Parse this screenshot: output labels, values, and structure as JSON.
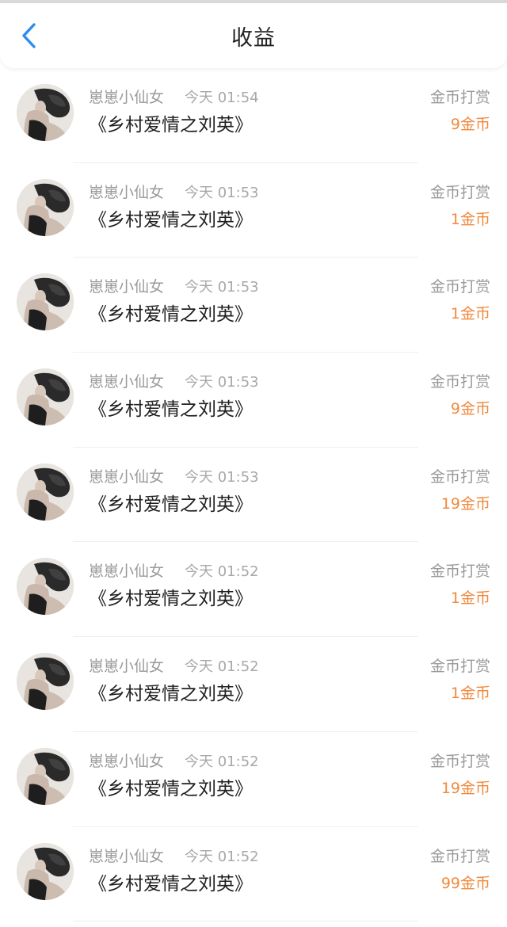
{
  "header": {
    "title": "收益",
    "back_icon": "chevron-left-icon",
    "accent": "#2d8cf0"
  },
  "amount_color": "#f08a3e",
  "records": [
    {
      "user": "崽崽小仙女",
      "time": "今天 01:54",
      "work": "《乡村爱情之刘英》",
      "type": "金币打赏",
      "amount": "9金币"
    },
    {
      "user": "崽崽小仙女",
      "time": "今天 01:53",
      "work": "《乡村爱情之刘英》",
      "type": "金币打赏",
      "amount": "1金币"
    },
    {
      "user": "崽崽小仙女",
      "time": "今天 01:53",
      "work": "《乡村爱情之刘英》",
      "type": "金币打赏",
      "amount": "1金币"
    },
    {
      "user": "崽崽小仙女",
      "time": "今天 01:53",
      "work": "《乡村爱情之刘英》",
      "type": "金币打赏",
      "amount": "9金币"
    },
    {
      "user": "崽崽小仙女",
      "time": "今天 01:53",
      "work": "《乡村爱情之刘英》",
      "type": "金币打赏",
      "amount": "19金币"
    },
    {
      "user": "崽崽小仙女",
      "time": "今天 01:52",
      "work": "《乡村爱情之刘英》",
      "type": "金币打赏",
      "amount": "1金币"
    },
    {
      "user": "崽崽小仙女",
      "time": "今天 01:52",
      "work": "《乡村爱情之刘英》",
      "type": "金币打赏",
      "amount": "1金币"
    },
    {
      "user": "崽崽小仙女",
      "time": "今天 01:52",
      "work": "《乡村爱情之刘英》",
      "type": "金币打赏",
      "amount": "19金币"
    },
    {
      "user": "崽崽小仙女",
      "time": "今天 01:52",
      "work": "《乡村爱情之刘英》",
      "type": "金币打赏",
      "amount": "99金币"
    }
  ]
}
